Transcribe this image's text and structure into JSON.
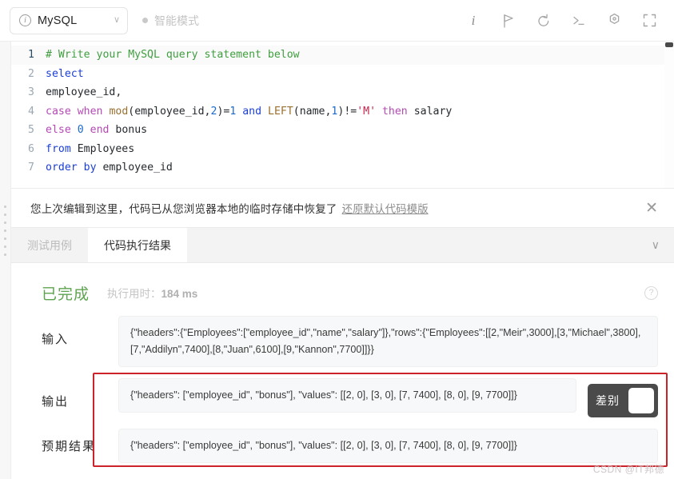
{
  "toolbar": {
    "language": "MySQL",
    "info_icon": "info-circle-icon",
    "chevron": "∨",
    "mode_label": "智能模式",
    "icons": [
      {
        "name": "info-icon",
        "glyph": "i"
      },
      {
        "name": "run-flag-icon",
        "glyph": "flag"
      },
      {
        "name": "reset-undo-icon",
        "glyph": "undo"
      },
      {
        "name": "console-terminal-icon",
        "glyph": "terminal"
      },
      {
        "name": "settings-gear-icon",
        "glyph": "gear"
      },
      {
        "name": "fullscreen-icon",
        "glyph": "fullscreen"
      }
    ]
  },
  "editor": {
    "lines": [
      {
        "num": "1",
        "tokens": [
          {
            "t": "# Write your MySQL query statement below",
            "c": "tk-com"
          }
        ]
      },
      {
        "num": "2",
        "tokens": [
          {
            "t": "select",
            "c": "tk-kw"
          }
        ]
      },
      {
        "num": "3",
        "tokens": [
          {
            "t": "employee_id,",
            "c": "tk-pl"
          }
        ]
      },
      {
        "num": "4",
        "tokens": [
          {
            "t": "case",
            "c": "tk-kw2"
          },
          {
            "t": " ",
            "c": "tk-pl"
          },
          {
            "t": "when",
            "c": "tk-kw2"
          },
          {
            "t": " ",
            "c": "tk-pl"
          },
          {
            "t": "mod",
            "c": "tk-fn"
          },
          {
            "t": "(employee_id,",
            "c": "tk-pl"
          },
          {
            "t": "2",
            "c": "tk-num"
          },
          {
            "t": ")=",
            "c": "tk-pl"
          },
          {
            "t": "1",
            "c": "tk-num"
          },
          {
            "t": " ",
            "c": "tk-pl"
          },
          {
            "t": "and",
            "c": "tk-kw"
          },
          {
            "t": " ",
            "c": "tk-pl"
          },
          {
            "t": "LEFT",
            "c": "tk-fn"
          },
          {
            "t": "(name,",
            "c": "tk-pl"
          },
          {
            "t": "1",
            "c": "tk-num"
          },
          {
            "t": ")!=",
            "c": "tk-pl"
          },
          {
            "t": "'M'",
            "c": "tk-str"
          },
          {
            "t": " ",
            "c": "tk-pl"
          },
          {
            "t": "then",
            "c": "tk-kw2"
          },
          {
            "t": " salary",
            "c": "tk-pl"
          }
        ]
      },
      {
        "num": "5",
        "tokens": [
          {
            "t": "else",
            "c": "tk-kw2"
          },
          {
            "t": " ",
            "c": "tk-pl"
          },
          {
            "t": "0",
            "c": "tk-num"
          },
          {
            "t": " ",
            "c": "tk-pl"
          },
          {
            "t": "end",
            "c": "tk-kw2"
          },
          {
            "t": " bonus",
            "c": "tk-pl"
          }
        ]
      },
      {
        "num": "6",
        "tokens": [
          {
            "t": "from",
            "c": "tk-kw"
          },
          {
            "t": " Employees",
            "c": "tk-pl"
          }
        ]
      },
      {
        "num": "7",
        "tokens": [
          {
            "t": "order",
            "c": "tk-kw"
          },
          {
            "t": " ",
            "c": "tk-pl"
          },
          {
            "t": "by",
            "c": "tk-kw"
          },
          {
            "t": " employee_id",
            "c": "tk-pl"
          }
        ]
      }
    ]
  },
  "notice": {
    "text": "您上次编辑到这里，代码已从您浏览器本地的临时存储中恢复了",
    "link": "还原默认代码模版",
    "close": "✕"
  },
  "tabs": [
    {
      "label": "测试用例",
      "active": false
    },
    {
      "label": "代码执行结果",
      "active": true
    }
  ],
  "tabs_chevron": "∨",
  "result": {
    "status": "已完成",
    "runtime_label": "执行用时：",
    "runtime_value": "184 ms",
    "help_glyph": "?",
    "rows": [
      {
        "label": "输入",
        "value": "{\"headers\":{\"Employees\":[\"employee_id\",\"name\",\"salary\"]},\"rows\":{\"Employees\":[[2,\"Meir\",3000],[3,\"Michael\",3800],[7,\"Addilyn\",7400],[8,\"Juan\",6100],[9,\"Kannon\",7700]]}}"
      },
      {
        "label": "输出",
        "value": "{\"headers\": [\"employee_id\", \"bonus\"], \"values\": [[2, 0], [3, 0], [7, 7400], [8, 0], [9, 7700]]}"
      },
      {
        "label": "预期结果",
        "value": "{\"headers\": [\"employee_id\", \"bonus\"], \"values\": [[2, 0], [3, 0], [7, 7400], [8, 0], [9, 7700]]}"
      }
    ],
    "diff_toggle_label": "差别"
  },
  "watermark": "CSDN @IT邦德",
  "colors": {
    "accent_red": "#cc2229",
    "status_green": "#5ea34f",
    "toggle_dark": "#4a4a4a"
  }
}
